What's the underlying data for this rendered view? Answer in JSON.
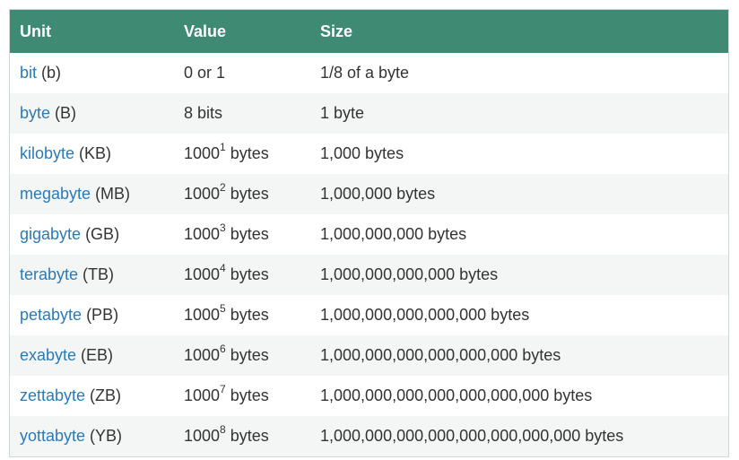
{
  "table": {
    "headers": {
      "unit": "Unit",
      "value": "Value",
      "size": "Size"
    },
    "rows": [
      {
        "unit": "bit",
        "abbr": " (b)",
        "value": "0 or 1",
        "exp": "",
        "value_suffix": "",
        "size": "1/8 of a byte"
      },
      {
        "unit": "byte",
        "abbr": " (B)",
        "value": "8 bits",
        "exp": "",
        "value_suffix": "",
        "size": "1 byte"
      },
      {
        "unit": "kilobyte",
        "abbr": " (KB)",
        "value": "1000",
        "exp": "1",
        "value_suffix": " bytes",
        "size": "1,000 bytes"
      },
      {
        "unit": "megabyte",
        "abbr": " (MB)",
        "value": "1000",
        "exp": "2",
        "value_suffix": " bytes",
        "size": "1,000,000 bytes"
      },
      {
        "unit": "gigabyte",
        "abbr": " (GB)",
        "value": "1000",
        "exp": "3",
        "value_suffix": " bytes",
        "size": "1,000,000,000 bytes"
      },
      {
        "unit": "terabyte",
        "abbr": " (TB)",
        "value": "1000",
        "exp": "4",
        "value_suffix": " bytes",
        "size": "1,000,000,000,000 bytes"
      },
      {
        "unit": "petabyte",
        "abbr": " (PB)",
        "value": "1000",
        "exp": "5",
        "value_suffix": " bytes",
        "size": "1,000,000,000,000,000 bytes"
      },
      {
        "unit": "exabyte",
        "abbr": " (EB)",
        "value": "1000",
        "exp": "6",
        "value_suffix": " bytes",
        "size": "1,000,000,000,000,000,000 bytes"
      },
      {
        "unit": "zettabyte",
        "abbr": " (ZB)",
        "value": "1000",
        "exp": "7",
        "value_suffix": " bytes",
        "size": "1,000,000,000,000,000,000,000 bytes"
      },
      {
        "unit": "yottabyte",
        "abbr": " (YB)",
        "value": "1000",
        "exp": "8",
        "value_suffix": " bytes",
        "size": "1,000,000,000,000,000,000,000,000 bytes"
      }
    ]
  },
  "colors": {
    "header_bg": "#3e8a72",
    "header_text": "#ffffff",
    "link": "#2a7ab8",
    "row_odd": "#f4f6f5",
    "row_even": "#ffffff",
    "text": "#333333"
  }
}
